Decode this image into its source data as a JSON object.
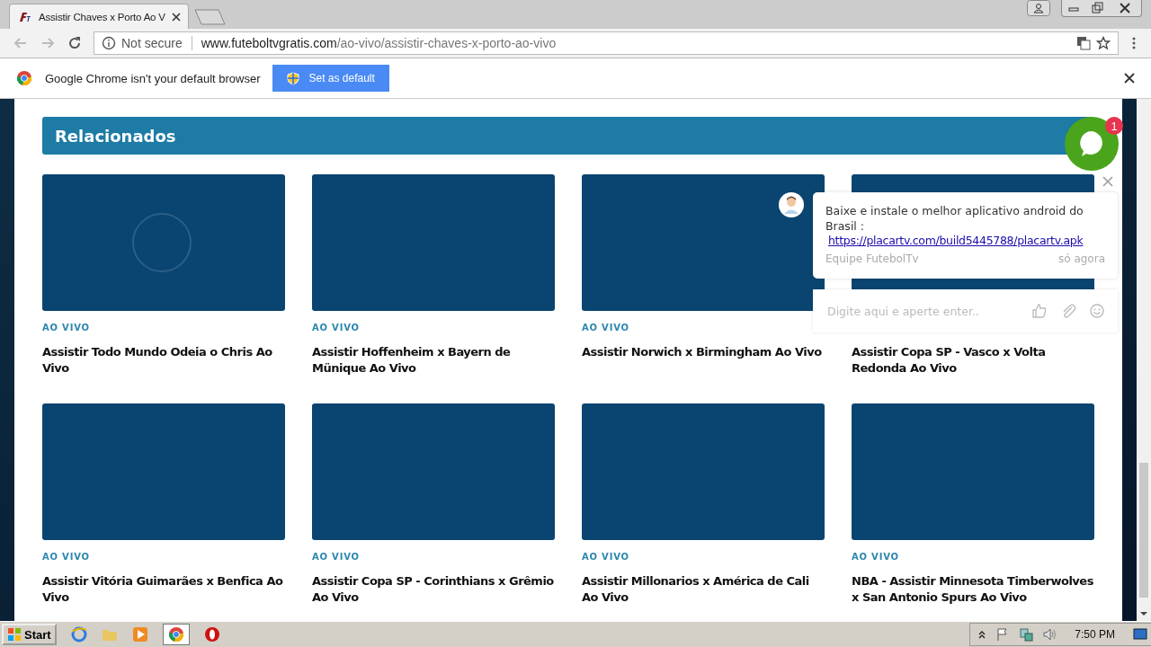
{
  "browser": {
    "tab": {
      "title": "Assistir Chaves x Porto Ao V",
      "selected": true
    },
    "security": "Not secure",
    "url_host": "www.futeboltvgratis.com",
    "url_path": "/ao-vivo/assistir-chaves-x-porto-ao-vivo"
  },
  "infobar": {
    "message": "Google Chrome isn't your default browser",
    "button": "Set as default"
  },
  "section": {
    "title": "Relacionados"
  },
  "cards": [
    {
      "label": "AO VIVO",
      "title": "Assistir Todo Mundo Odeia o Chris Ao Vivo",
      "loading": true
    },
    {
      "label": "AO VIVO",
      "title": "Assistir Hoffenheim x Bayern de Münique Ao Vivo",
      "loading": false
    },
    {
      "label": "AO VIVO",
      "title": "Assistir Norwich x Birmingham Ao Vivo",
      "loading": false
    },
    {
      "title": "Assistir Copa SP - Vasco x Volta Redonda Ao Vivo"
    },
    {
      "label": "AO VIVO",
      "title": "Assistir Vitória Guimarães x Benfica Ao Vivo",
      "loading": false
    },
    {
      "label": "AO VIVO",
      "title": "Assistir Copa SP - Corinthians x Grêmio Ao Vivo",
      "loading": false
    },
    {
      "label": "AO VIVO",
      "title": "Assistir Millonarios x América de Cali Ao Vivo",
      "loading": false
    },
    {
      "label": "AO VIVO",
      "title": "NBA - Assistir Minnesota Timberwolves x San Antonio Spurs Ao Vivo",
      "loading": false
    }
  ],
  "chat": {
    "badge": "1",
    "message": "Baixe e instale o melhor aplicativo android do Brasil :",
    "link": "https://placartv.com/build5445788/placartv.apk",
    "sender": "Equipe FutebolTv",
    "time": "só agora",
    "input_placeholder": "Digite aqui e aperte enter.."
  },
  "taskbar": {
    "start": "Start",
    "clock": "7:50 PM"
  }
}
